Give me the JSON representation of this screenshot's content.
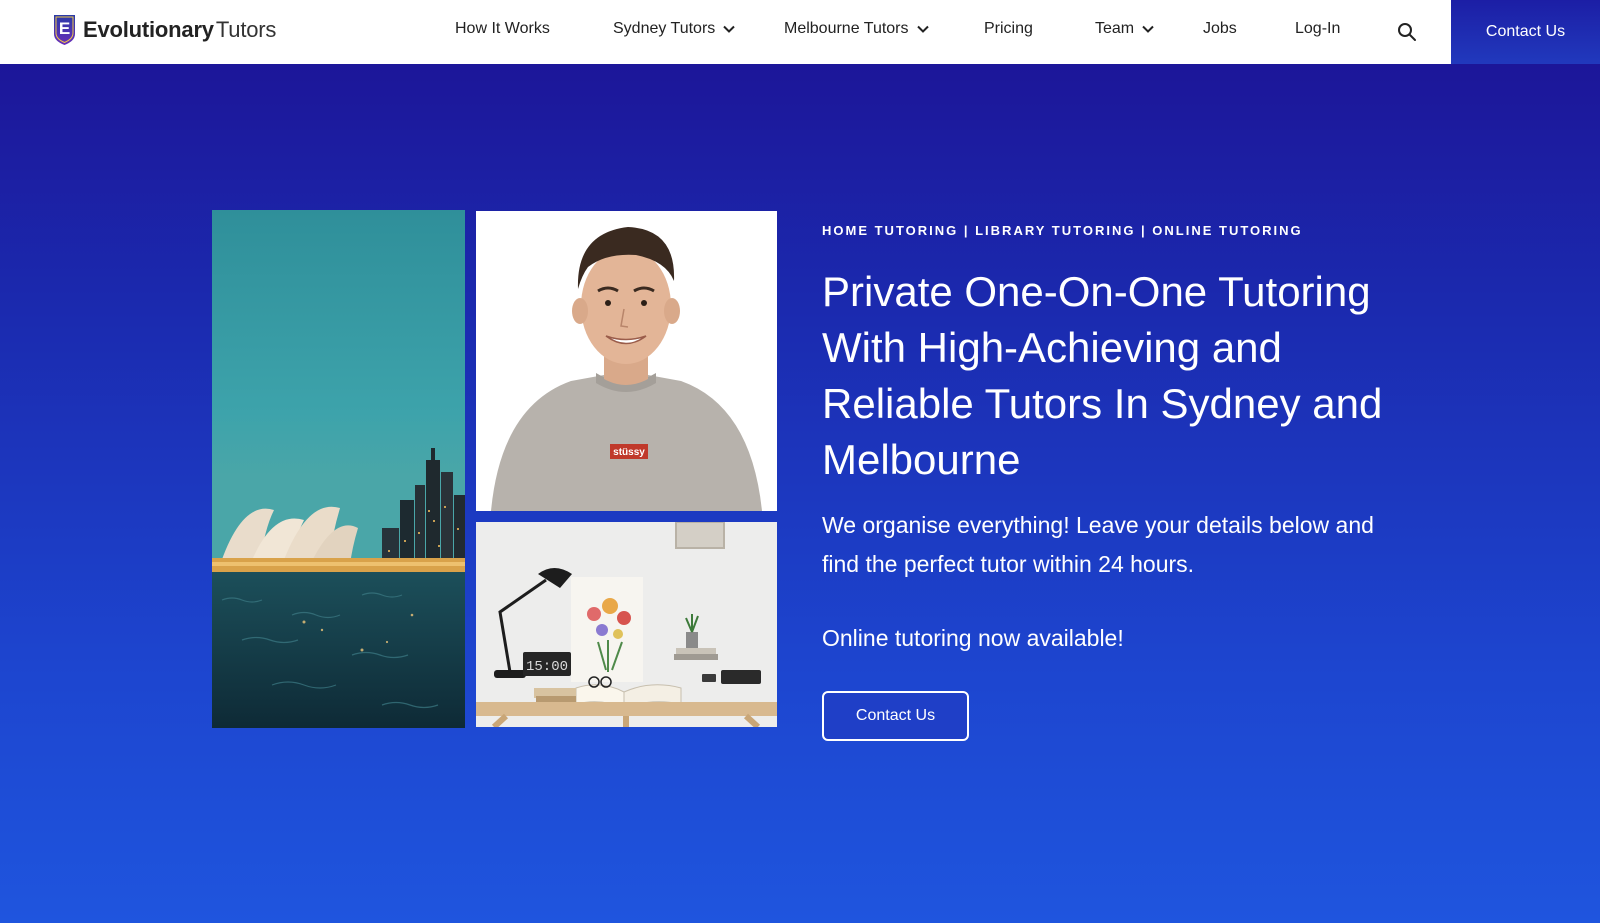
{
  "brand": {
    "name_bold": "Evolutionary",
    "name_light": "Tutors",
    "logo_letter": "E"
  },
  "nav": {
    "items": [
      {
        "label": "How It Works"
      },
      {
        "label": "Sydney Tutors"
      },
      {
        "label": "Melbourne Tutors"
      },
      {
        "label": "Pricing"
      },
      {
        "label": "Team"
      },
      {
        "label": "Jobs"
      },
      {
        "label": "Log-In"
      }
    ],
    "contact_label": "Contact Us"
  },
  "hero": {
    "eyebrow": "HOME TUTORING | LIBRARY TUTORING | ONLINE TUTORING",
    "headline": "Private One-On-One Tutoring With High-Achieving and Reliable Tutors In Sydney and Melbourne",
    "subtext": "We organise everything! Leave your details below and find the perfect tutor within 24 hours.",
    "online_note": "Online tutoring now available!",
    "cta_label": "Contact Us",
    "shirt_logo": "stüssy",
    "clock_time": "15:00"
  },
  "colors": {
    "accent": "#1f3fc7",
    "hero_top": "#1c1699",
    "hero_bottom": "#1f55de",
    "nav_bg": "#ffffff"
  },
  "icons": {
    "logo": "shield-e-icon",
    "dropdown": "chevron-down-icon",
    "search": "search-icon"
  }
}
